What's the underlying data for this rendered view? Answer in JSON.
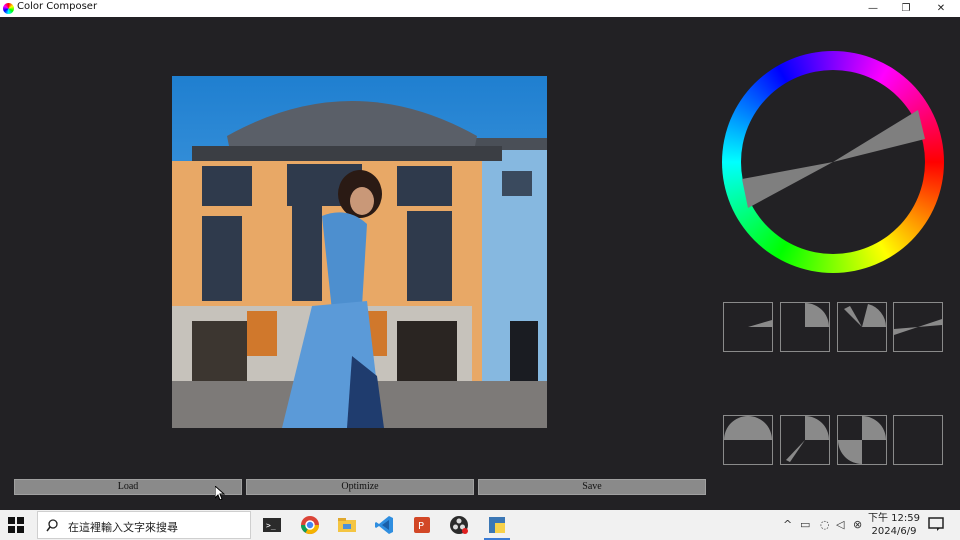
{
  "window": {
    "title": "Color Composer",
    "minimize_glyph": "—",
    "restore_glyph": "❐",
    "close_glyph": "✕"
  },
  "image": {
    "description": "photo",
    "icon": "photo-image"
  },
  "color_wheel": {
    "icon": "hue-wheel-icon"
  },
  "templates": [
    {
      "icon": "harmony-template-i"
    },
    {
      "icon": "harmony-template-v"
    },
    {
      "icon": "harmony-template-l"
    },
    {
      "icon": "harmony-template-I"
    },
    {
      "icon": "harmony-template-T"
    },
    {
      "icon": "harmony-template-Y"
    },
    {
      "icon": "harmony-template-X"
    },
    {
      "icon": "harmony-template-N"
    }
  ],
  "buttons": {
    "load": "Load",
    "optimize": "Optimize",
    "save": "Save"
  },
  "taskbar": {
    "search_placeholder": "在這裡輸入文字來搜尋",
    "time": "下午 12:59",
    "date": "2024/6/9",
    "apps": [
      "terminal-icon",
      "chrome-icon",
      "file-explorer-icon",
      "vscode-icon",
      "powerpoint-icon",
      "obs-icon",
      "python-app-icon"
    ]
  },
  "colors": {
    "background": "#222124",
    "accent_gray": "#8a8a8a",
    "sector_gray": "#7f7f7f"
  }
}
